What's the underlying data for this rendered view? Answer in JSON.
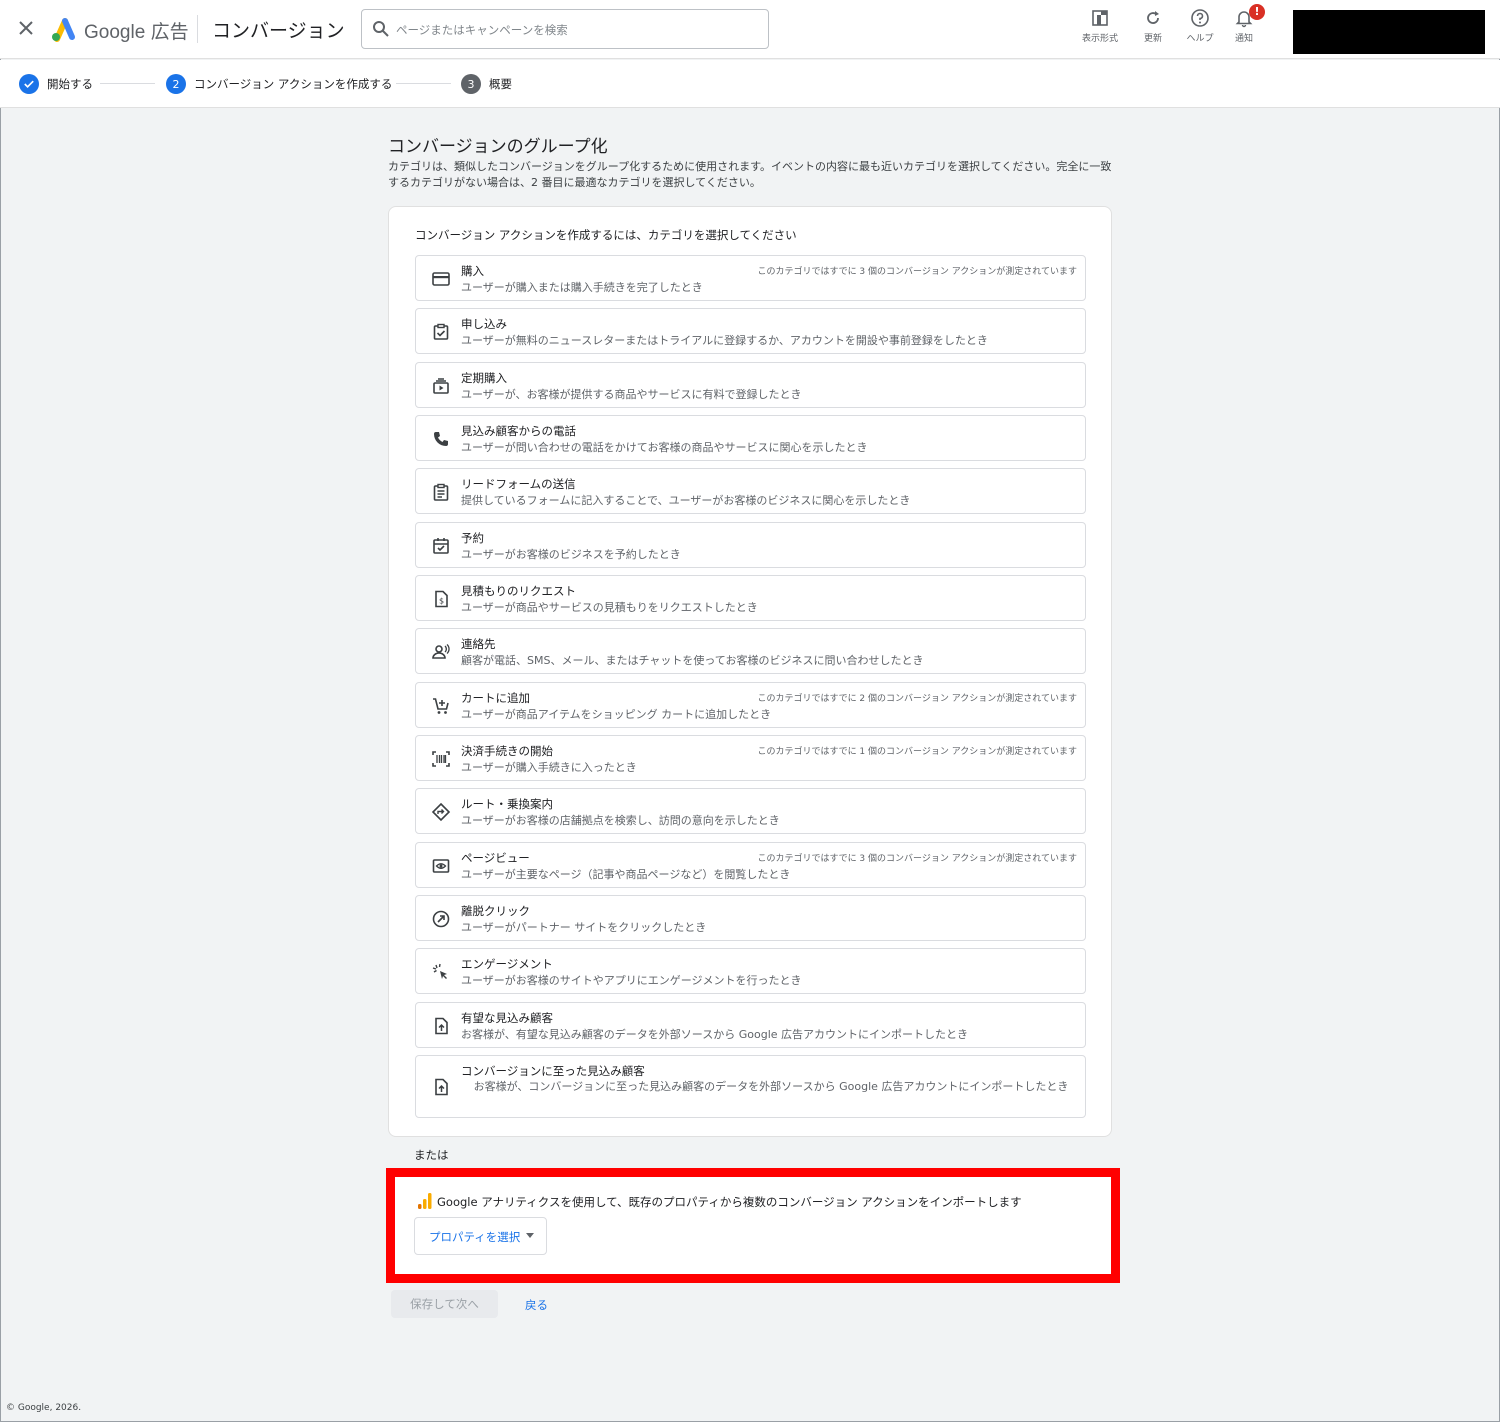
{
  "header": {
    "brand_google": "Google",
    "brand_ads": "広告",
    "page_title": "コンバージョン",
    "search_placeholder": "ページまたはキャンペーンを検索",
    "tools": [
      {
        "label": "表示形式",
        "icon": "appearance-icon"
      },
      {
        "label": "更新",
        "icon": "refresh-icon"
      },
      {
        "label": "ヘルプ",
        "icon": "help-icon"
      },
      {
        "label": "通知",
        "icon": "bell-icon"
      }
    ],
    "notification_badge": "!"
  },
  "stepper": {
    "steps": [
      {
        "number": "",
        "label": "開始する",
        "state": "complete"
      },
      {
        "number": "2",
        "label": "コンバージョン アクションを作成する",
        "state": "active"
      },
      {
        "number": "3",
        "label": "概要",
        "state": "pending"
      }
    ]
  },
  "main": {
    "title": "コンバージョンのグループ化",
    "description": "カテゴリは、類似したコンバージョンをグループ化するために使用されます。イベントの内容に最も近いカテゴリを選択してください。完全に一致するカテゴリがない場合は、2 番目に最適なカテゴリを選択してください。",
    "card_prompt": "コンバージョン アクションを作成するには、カテゴリを選択してください",
    "categories": [
      {
        "title": "購入",
        "desc": "ユーザーが購入または購入手続きを完了したとき",
        "note": "このカテゴリではすでに 3 個のコンバージョン アクションが測定されています",
        "icon": "credit-card-icon"
      },
      {
        "title": "申し込み",
        "desc": "ユーザーが無料のニュースレターまたはトライアルに登録するか、アカウントを開設や事前登録をしたとき",
        "note": "",
        "icon": "checklist-icon"
      },
      {
        "title": "定期購入",
        "desc": "ユーザーが、お客様が提供する商品やサービスに有料で登録したとき",
        "note": "",
        "icon": "subscriptions-icon"
      },
      {
        "title": "見込み顧客からの電話",
        "desc": "ユーザーが問い合わせの電話をかけてお客様の商品やサービスに関心を示したとき",
        "note": "",
        "icon": "phone-icon"
      },
      {
        "title": "リードフォームの送信",
        "desc": "提供しているフォームに記入することで、ユーザーがお客様のビジネスに関心を示したとき",
        "note": "",
        "icon": "clipboard-icon"
      },
      {
        "title": "予約",
        "desc": "ユーザーがお客様のビジネスを予約したとき",
        "note": "",
        "icon": "calendar-check-icon"
      },
      {
        "title": "見積もりのリクエスト",
        "desc": "ユーザーが商品やサービスの見積もりをリクエストしたとき",
        "note": "",
        "icon": "quote-document-icon"
      },
      {
        "title": "連絡先",
        "desc": "顧客が電話、SMS、メール、またはチャットを使ってお客様のビジネスに問い合わせしたとき",
        "note": "",
        "icon": "contact-person-icon"
      },
      {
        "title": "カートに追加",
        "desc": "ユーザーが商品アイテムをショッピング カートに追加したとき",
        "note": "このカテゴリではすでに 2 個のコンバージョン アクションが測定されています",
        "icon": "add-cart-icon"
      },
      {
        "title": "決済手続きの開始",
        "desc": "ユーザーが購入手続きに入ったとき",
        "note": "このカテゴリではすでに 1 個のコンバージョン アクションが測定されています",
        "icon": "barcode-scan-icon"
      },
      {
        "title": "ルート・乗換案内",
        "desc": "ユーザーがお客様の店舗拠点を検索し、訪問の意向を示したとき",
        "note": "",
        "icon": "directions-icon"
      },
      {
        "title": "ページビュー",
        "desc": "ユーザーが主要なページ（記事や商品ページなど）を閲覧したとき",
        "note": "このカテゴリではすでに 3 個のコンバージョン アクションが測定されています",
        "icon": "page-view-icon"
      },
      {
        "title": "離脱クリック",
        "desc": "ユーザーがパートナー サイトをクリックしたとき",
        "note": "",
        "icon": "outbound-arrow-icon"
      },
      {
        "title": "エンゲージメント",
        "desc": "ユーザーがお客様のサイトやアプリにエンゲージメントを行ったとき",
        "note": "",
        "icon": "click-sparkle-icon"
      },
      {
        "title": "有望な見込み顧客",
        "desc": "お客様が、有望な見込み顧客のデータを外部ソースから Google 広告アカウントにインポートしたとき",
        "note": "",
        "icon": "file-upload-icon"
      },
      {
        "title": "コンバージョンに至った見込み顧客",
        "desc": "お客様が、コンバージョンに至った見込み顧客のデータを外部ソースから Google 広告アカウントにインポートしたとき",
        "note": "",
        "icon": "file-upload-icon"
      }
    ],
    "or_text": "または",
    "ga_text": "Google アナリティクスを使用して、既存のプロパティから複数のコンバージョン アクションをインポートします",
    "ga_button": "プロパティを選択",
    "save_button": "保存して次へ",
    "back_link": "戻る"
  },
  "footer": "© Google, 2026.",
  "colors": {
    "accent": "#1a73e8",
    "highlight_border": "#ff0000",
    "badge": "#d93025",
    "ga_orange": "#f9ab00",
    "ga_dark_orange": "#e37400"
  }
}
